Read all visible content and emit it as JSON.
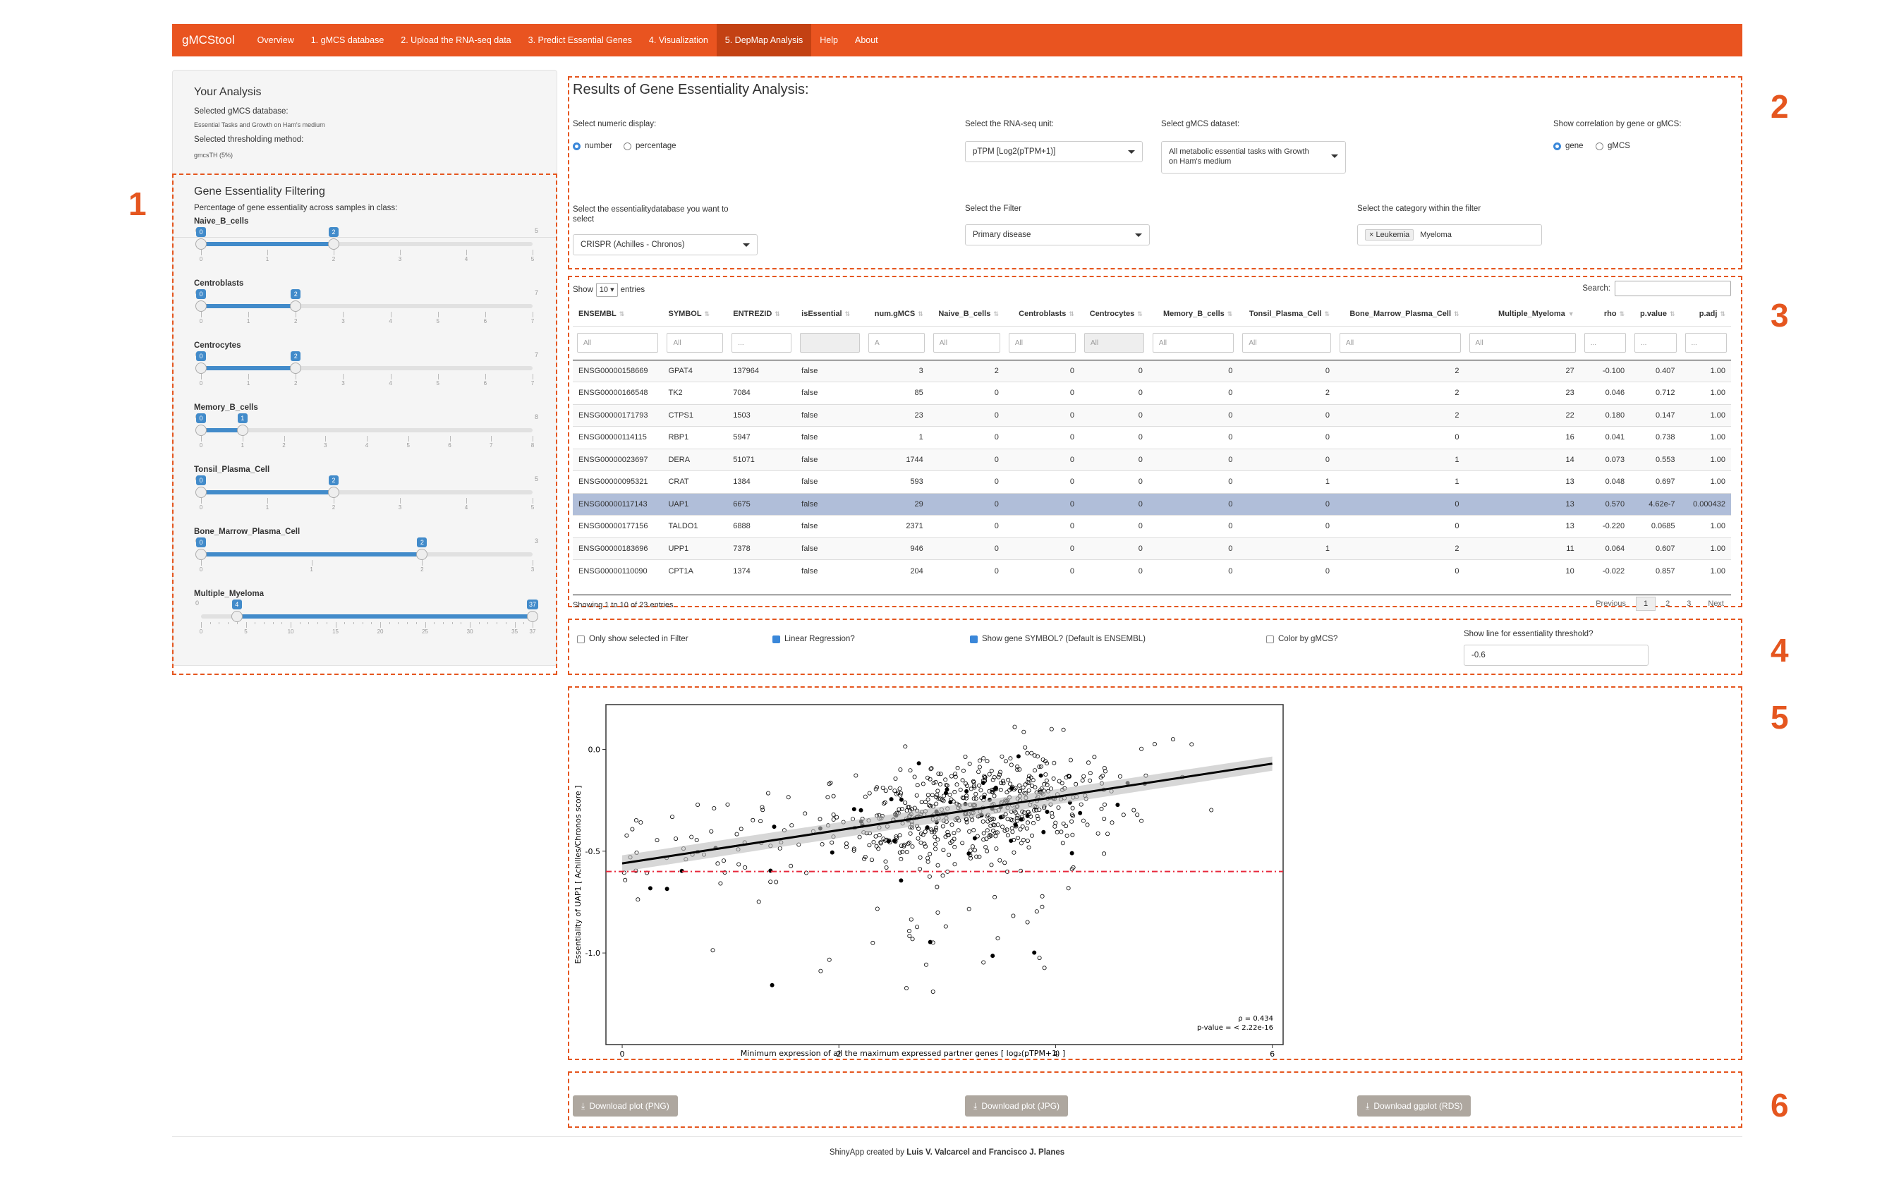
{
  "navbar": {
    "brand": "gMCStool",
    "items": [
      "Overview",
      "1. gMCS database",
      "2. Upload the RNA-seq data",
      "3. Predict Essential Genes",
      "4. Visualization",
      "5. DepMap Analysis",
      "Help",
      "About"
    ],
    "active_index": 5
  },
  "sidebar": {
    "analysis_title": "Your Analysis",
    "db_label": "Selected gMCS database:",
    "db_value": "Essential Tasks and Growth on Ham's medium",
    "thr_label": "Selected thresholding method:",
    "thr_value": "gmcsTH (5%)",
    "filter_title": "Gene Essentiality Filtering",
    "filter_subtitle": "Percentage of gene essentiality across samples in class:",
    "sliders": [
      {
        "label": "Naive_B_cells",
        "min": 0,
        "max": 5,
        "low": 0,
        "high": 2
      },
      {
        "label": "Centroblasts",
        "min": 0,
        "max": 7,
        "low": 0,
        "high": 2
      },
      {
        "label": "Centrocytes",
        "min": 0,
        "max": 7,
        "low": 0,
        "high": 2
      },
      {
        "label": "Memory_B_cells",
        "min": 0,
        "max": 8,
        "low": 0,
        "high": 1
      },
      {
        "label": "Tonsil_Plasma_Cell",
        "min": 0,
        "max": 5,
        "low": 0,
        "high": 2
      },
      {
        "label": "Bone_Marrow_Plasma_Cell",
        "min": 0,
        "max": 3,
        "low": 0,
        "high": 2
      },
      {
        "label": "Multiple_Myeloma",
        "min": 0,
        "max": 37,
        "low": 4,
        "high": 37
      }
    ]
  },
  "controls": {
    "results_title": "Results of Gene Essentiality Analysis:",
    "numeric_display_label": "Select numeric display:",
    "numeric_opt1": "number",
    "numeric_opt2": "percentage",
    "rnaseq_unit_label": "Select the RNA-seq unit:",
    "rnaseq_unit_value": "pTPM [Log2(pTPM+1)]",
    "gmcs_dataset_label": "Select gMCS dataset:",
    "gmcs_dataset_value_line1": "All metabolic essential tasks with Growth",
    "gmcs_dataset_value_line2": "on Ham's medium",
    "correlation_label": "Show correlation by gene or gMCS:",
    "corr_opt1": "gene",
    "corr_opt2": "gMCS",
    "essentiality_db_label_line1": "Select the essentialitydatabase you want to",
    "essentiality_db_label_line2": "select",
    "essentiality_db_value": "CRISPR (Achilles - Chronos)",
    "filter_label": "Select the Filter",
    "filter_value": "Primary disease",
    "category_label": "Select the category within the filter",
    "category_chips": [
      "Leukemia",
      "Myeloma"
    ]
  },
  "table": {
    "show_label": "Show",
    "entries_value": "10",
    "entries_label": "entries",
    "search_label": "Search:",
    "columns": [
      "ENSEMBL",
      "SYMBOL",
      "ENTREZID",
      "isEssential",
      "num.gMCS",
      "Naive_B_cells",
      "Centroblasts",
      "Centrocytes",
      "Memory_B_cells",
      "Tonsil_Plasma_Cell",
      "Bone_Marrow_Plasma_Cell",
      "Multiple_Myeloma",
      "rho",
      "p.value",
      "p.adj"
    ],
    "filters": [
      "All",
      "All",
      "...",
      "",
      "A",
      "All",
      "All",
      "All",
      "All",
      "All",
      "All",
      "All",
      "...",
      "...",
      "..."
    ],
    "rows": [
      [
        "ENSG00000158669",
        "GPAT4",
        "137964",
        "false",
        "3",
        "2",
        "0",
        "0",
        "0",
        "0",
        "2",
        "27",
        "-0.100",
        "0.407",
        "1.00"
      ],
      [
        "ENSG00000166548",
        "TK2",
        "7084",
        "false",
        "85",
        "0",
        "0",
        "0",
        "0",
        "2",
        "2",
        "23",
        "0.046",
        "0.712",
        "1.00"
      ],
      [
        "ENSG00000171793",
        "CTPS1",
        "1503",
        "false",
        "23",
        "0",
        "0",
        "0",
        "0",
        "0",
        "2",
        "22",
        "0.180",
        "0.147",
        "1.00"
      ],
      [
        "ENSG00000114115",
        "RBP1",
        "5947",
        "false",
        "1",
        "0",
        "0",
        "0",
        "0",
        "0",
        "0",
        "16",
        "0.041",
        "0.738",
        "1.00"
      ],
      [
        "ENSG00000023697",
        "DERA",
        "51071",
        "false",
        "1744",
        "0",
        "0",
        "0",
        "0",
        "0",
        "1",
        "14",
        "0.073",
        "0.553",
        "1.00"
      ],
      [
        "ENSG00000095321",
        "CRAT",
        "1384",
        "false",
        "593",
        "0",
        "0",
        "0",
        "0",
        "1",
        "1",
        "13",
        "0.048",
        "0.697",
        "1.00"
      ],
      [
        "ENSG00000117143",
        "UAP1",
        "6675",
        "false",
        "29",
        "0",
        "0",
        "0",
        "0",
        "0",
        "0",
        "13",
        "0.570",
        "4.62e-7",
        "0.000432"
      ],
      [
        "ENSG00000177156",
        "TALDO1",
        "6888",
        "false",
        "2371",
        "0",
        "0",
        "0",
        "0",
        "0",
        "0",
        "13",
        "-0.220",
        "0.0685",
        "1.00"
      ],
      [
        "ENSG00000183696",
        "UPP1",
        "7378",
        "false",
        "946",
        "0",
        "0",
        "0",
        "0",
        "1",
        "2",
        "11",
        "0.064",
        "0.607",
        "1.00"
      ],
      [
        "ENSG00000110090",
        "CPT1A",
        "1374",
        "false",
        "204",
        "0",
        "0",
        "0",
        "0",
        "0",
        "0",
        "10",
        "-0.022",
        "0.857",
        "1.00"
      ]
    ],
    "selected_row": 6,
    "info": "Showing 1 to 10 of 23 entries",
    "pager": [
      "Previous",
      "1",
      "2",
      "3",
      "Next"
    ]
  },
  "options": {
    "only_selected": "Only show selected in Filter",
    "linear_regression": "Linear Regression?",
    "show_symbol": "Show gene SYMBOL? (Default is ENSEMBL)",
    "color_gmcs": "Color by gMCS?",
    "threshold_label": "Show line for essentiality threshold?",
    "threshold_value": "-0.6"
  },
  "chart_data": {
    "type": "scatter",
    "title": "",
    "xlabel": "Minimum expression of all the maximum expressed partner genes [ log₂(pTPM+1) ]",
    "ylabel": "Essentiality of UAP1 [ Achilles/Chronos score ]",
    "xlim": [
      -0.15,
      6.1
    ],
    "ylim": [
      -1.45,
      0.22
    ],
    "x_ticks": [
      "0",
      "2",
      "4",
      "6"
    ],
    "y_ticks": [
      "0.0",
      "-0.5",
      "-1.0"
    ],
    "regression": {
      "x": [
        0,
        6
      ],
      "y": [
        -0.56,
        -0.07
      ]
    },
    "threshold_y": -0.6,
    "annotation": [
      "ρ = 0.434",
      "p-value = < 2.22e-16"
    ],
    "n_points": 700,
    "colors": {
      "points": "#000000",
      "line": "#000000",
      "band": "#bdbdbd",
      "threshold": "#e8293c"
    }
  },
  "downloads": [
    "Download plot (PNG)",
    "Download plot (JPG)",
    "Download ggplot (RDS)"
  ],
  "footer": {
    "prefix": "ShinyApp created by ",
    "authors": "Luis V. Valcarcel and Francisco J. Planes"
  },
  "section_numbers": [
    "1",
    "2",
    "3",
    "4",
    "5",
    "6"
  ]
}
